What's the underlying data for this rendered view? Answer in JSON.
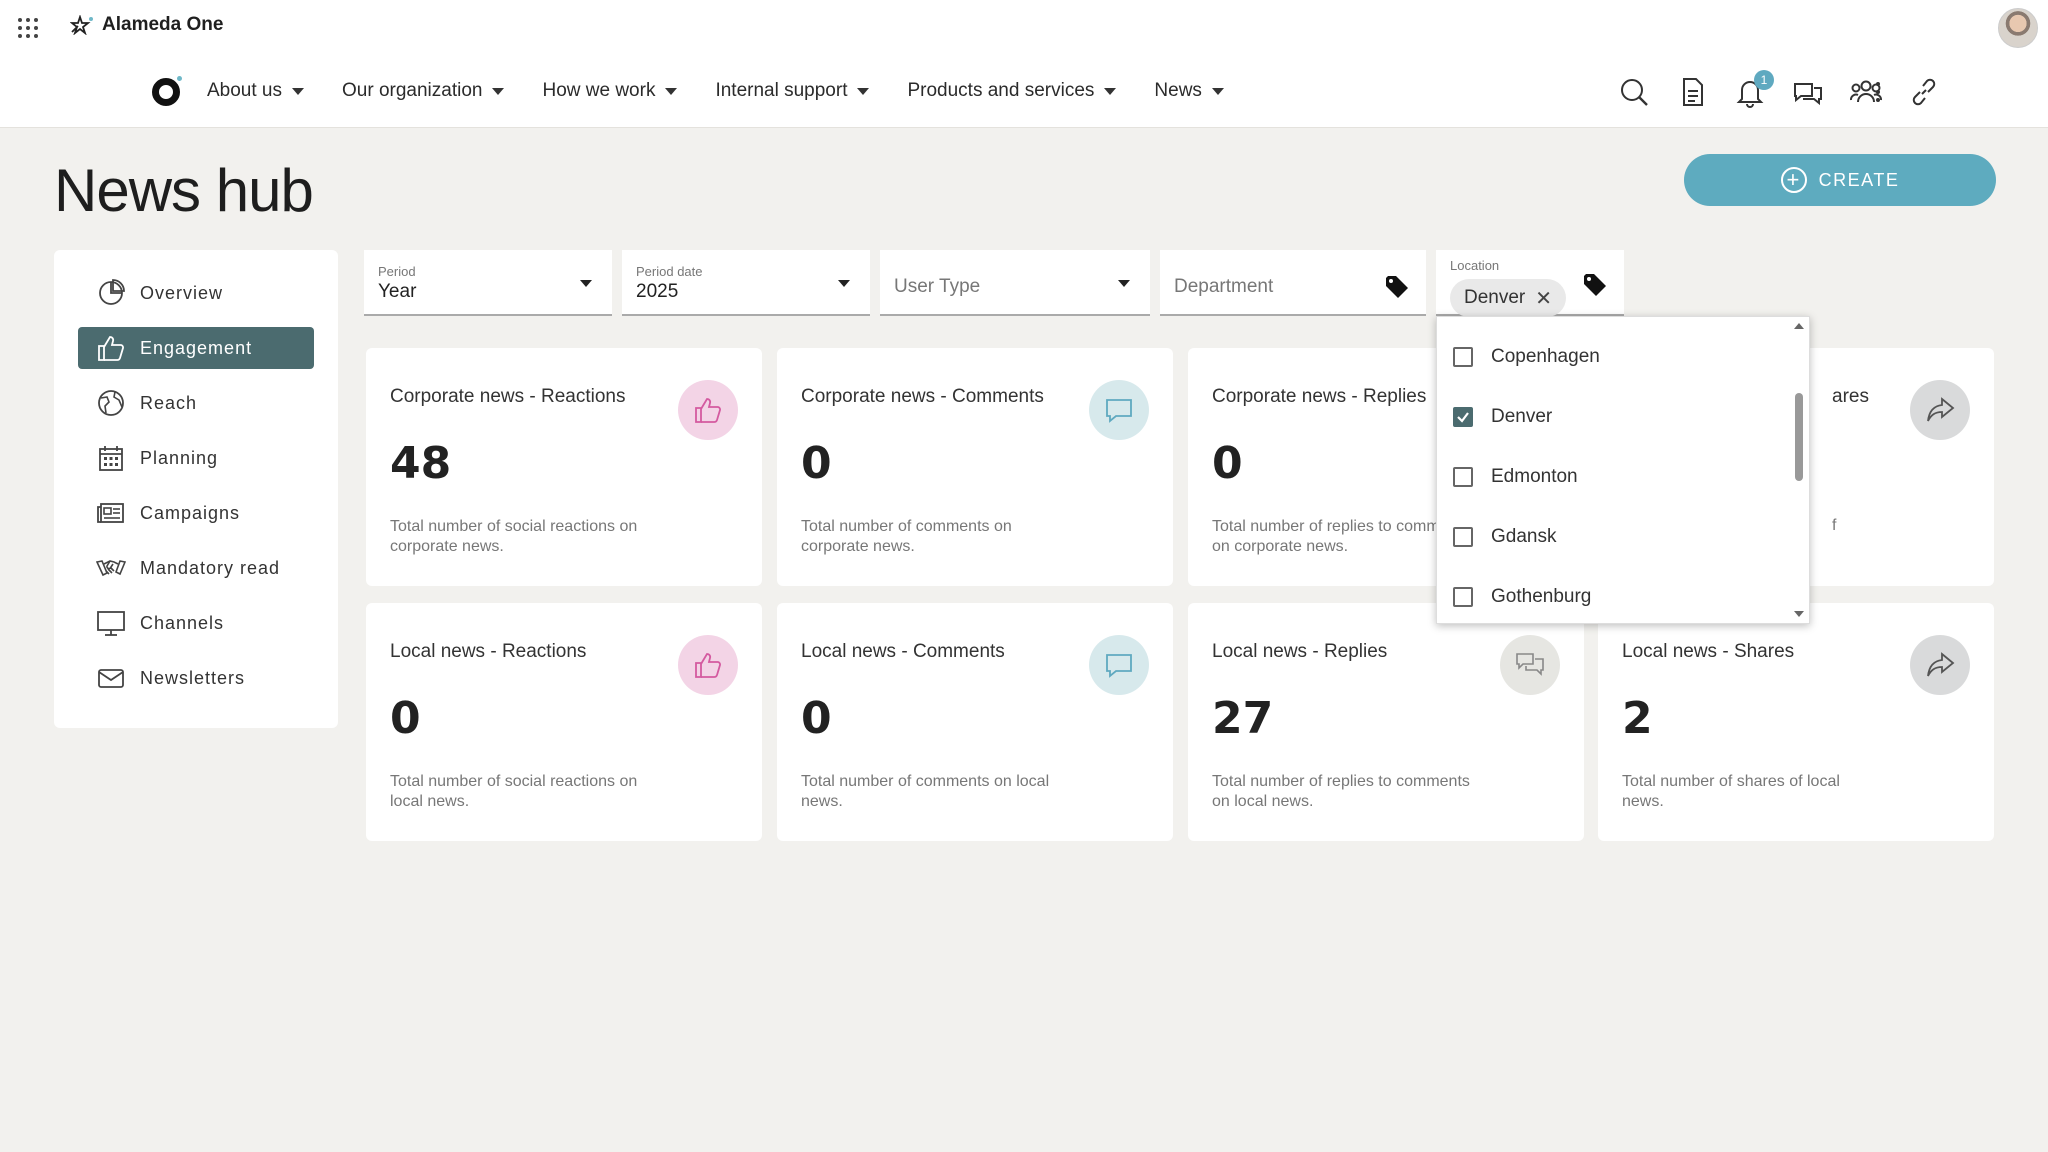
{
  "brand": {
    "name": "Alameda One"
  },
  "nav": {
    "items": [
      {
        "label": "About us"
      },
      {
        "label": "Our organization"
      },
      {
        "label": "How we work"
      },
      {
        "label": "Internal support"
      },
      {
        "label": "Products and services"
      },
      {
        "label": "News"
      }
    ],
    "notification_count": "1"
  },
  "page": {
    "title": "News hub",
    "create_label": "CREATE"
  },
  "sidebar": {
    "items": [
      {
        "label": "Overview",
        "icon": "pie-chart-icon"
      },
      {
        "label": "Engagement",
        "icon": "thumbs-up-icon",
        "active": true
      },
      {
        "label": "Reach",
        "icon": "globe-icon"
      },
      {
        "label": "Planning",
        "icon": "calendar-icon"
      },
      {
        "label": "Campaigns",
        "icon": "newspaper-icon"
      },
      {
        "label": "Mandatory read",
        "icon": "handshake-icon"
      },
      {
        "label": "Channels",
        "icon": "monitor-icon"
      },
      {
        "label": "Newsletters",
        "icon": "envelope-icon"
      }
    ]
  },
  "filters": {
    "period": {
      "label": "Period",
      "value": "Year"
    },
    "period_date": {
      "label": "Period date",
      "value": "2025"
    },
    "user_type": {
      "placeholder": "User Type"
    },
    "department": {
      "placeholder": "Department"
    },
    "location": {
      "label": "Location",
      "chip": "Denver"
    }
  },
  "location_dropdown": {
    "options": [
      {
        "label": "Copenhagen",
        "checked": false
      },
      {
        "label": "Denver",
        "checked": true
      },
      {
        "label": "Edmonton",
        "checked": false
      },
      {
        "label": "Gdansk",
        "checked": false
      },
      {
        "label": "Gothenburg",
        "checked": false
      }
    ]
  },
  "cards": {
    "corporate": [
      {
        "title": "Corporate news - Reactions",
        "value": "48",
        "desc": "Total number of social reactions on corporate news."
      },
      {
        "title": "Corporate news - Comments",
        "value": "0",
        "desc": "Total number of comments on corporate news."
      },
      {
        "title": "Corporate news - Replies",
        "value": "0",
        "desc": "Total number of replies to comments on corporate news."
      },
      {
        "title_partial": "ares",
        "desc_partial": "f"
      }
    ],
    "local": [
      {
        "title": "Local news - Reactions",
        "value": "0",
        "desc": "Total number of social reactions on local news."
      },
      {
        "title": "Local news - Comments",
        "value": "0",
        "desc": "Total number of comments on local news."
      },
      {
        "title": "Local news - Replies",
        "value": "27",
        "desc": "Total number of replies to comments on local news."
      },
      {
        "title": "Local news - Shares",
        "value": "2",
        "desc": "Total number of shares of local news."
      }
    ]
  },
  "colors": {
    "accent": "#5eabbf",
    "sidebar_active": "#4b6b6f",
    "reactions_bg": "#f3d4e6",
    "reactions_fg": "#d45aa0",
    "comments_bg": "#d7e9ec",
    "comments_fg": "#5fa9c0",
    "replies_bg": "#e6e6e2",
    "shares_bg": "#d9dadb"
  }
}
